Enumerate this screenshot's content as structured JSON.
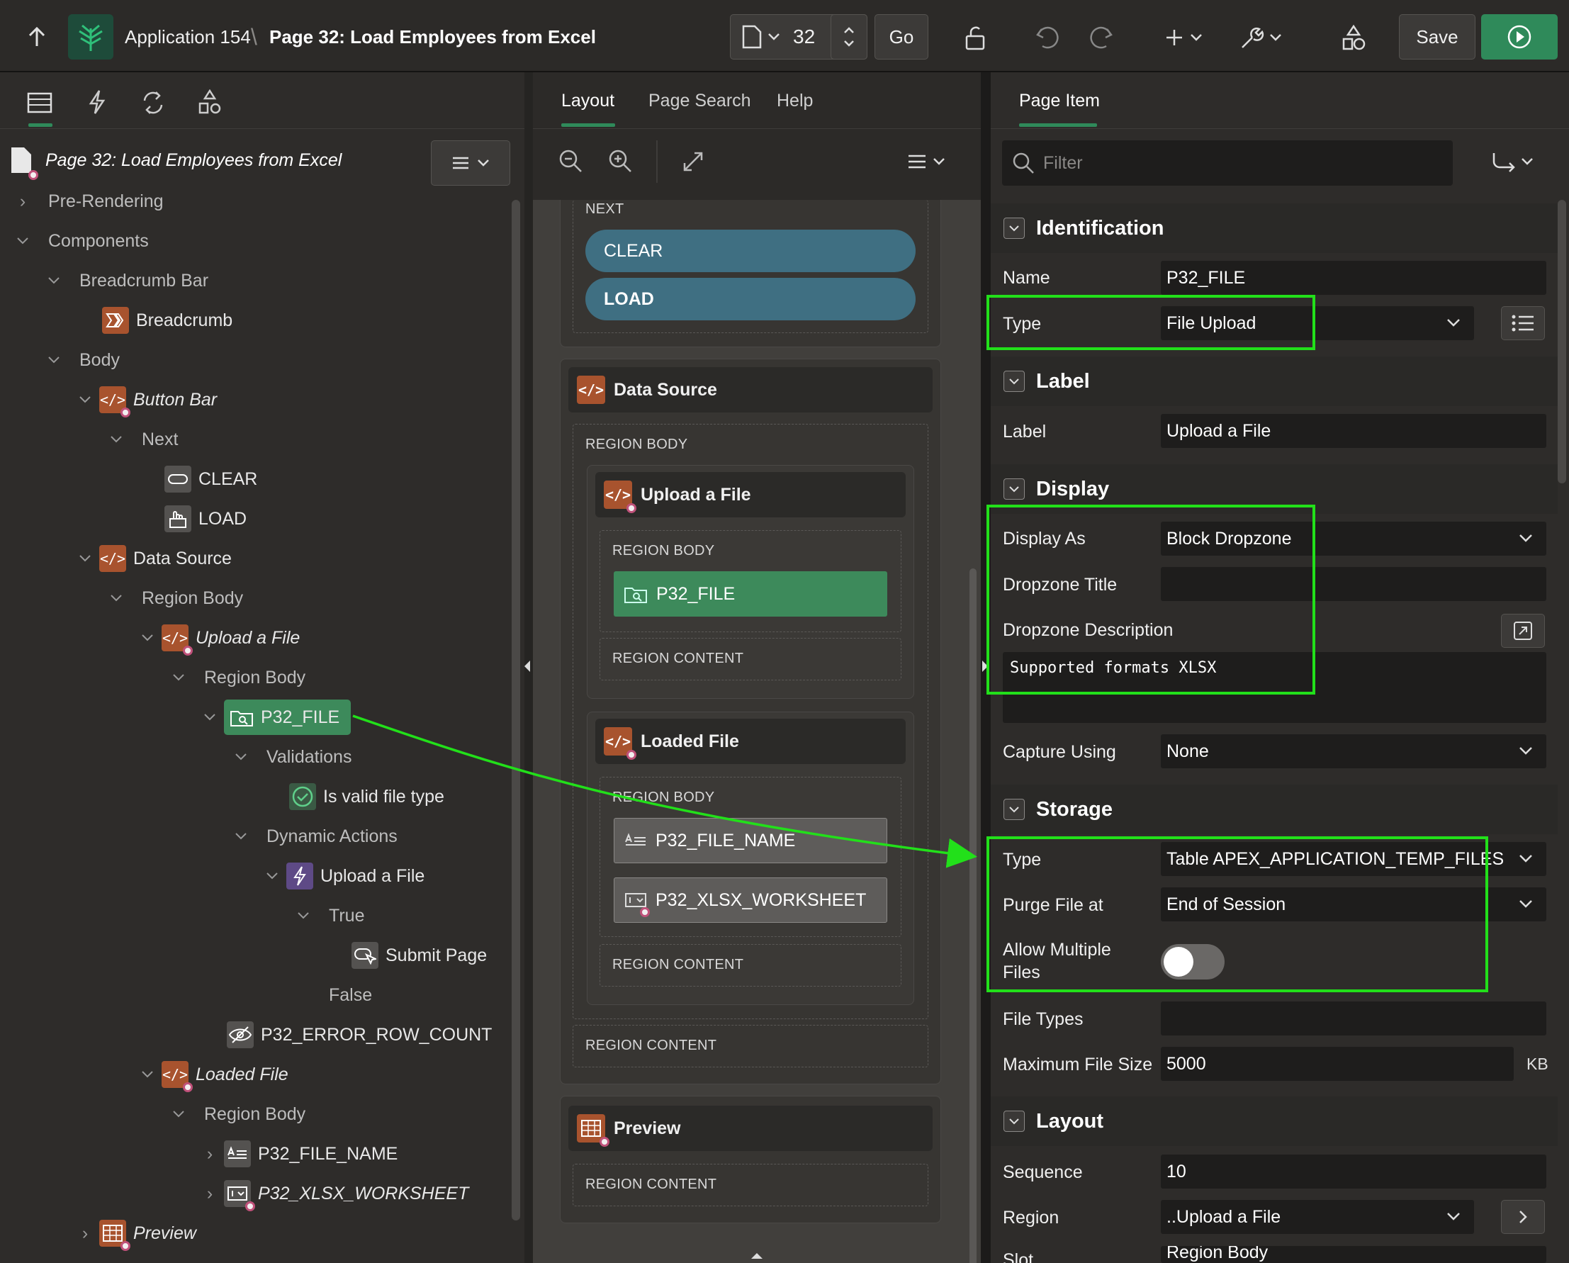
{
  "topbar": {
    "app_name": "Application 154",
    "separator": "\\",
    "page_title": "Page 32: Load Employees from Excel",
    "page_number": "32",
    "go_label": "Go",
    "save_label": "Save"
  },
  "left_panel": {
    "root_label": "Page 32: Load Employees from Excel",
    "tree": [
      {
        "label": "Pre-Rendering"
      },
      {
        "label": "Components"
      },
      {
        "label": "Breadcrumb Bar"
      },
      {
        "label": "Breadcrumb"
      },
      {
        "label": "Body"
      },
      {
        "label": "Button Bar"
      },
      {
        "label": "Next"
      },
      {
        "label": "CLEAR"
      },
      {
        "label": "LOAD"
      },
      {
        "label": "Data Source"
      },
      {
        "label": "Region Body"
      },
      {
        "label": "Upload a File"
      },
      {
        "label": "Region Body"
      },
      {
        "label": "P32_FILE"
      },
      {
        "label": "Validations"
      },
      {
        "label": "Is valid file type"
      },
      {
        "label": "Dynamic Actions"
      },
      {
        "label": "Upload a File"
      },
      {
        "label": "True"
      },
      {
        "label": "Submit Page"
      },
      {
        "label": "False"
      },
      {
        "label": "P32_ERROR_ROW_COUNT"
      },
      {
        "label": "Loaded File"
      },
      {
        "label": "Region Body"
      },
      {
        "label": "P32_FILE_NAME"
      },
      {
        "label": "P32_XLSX_WORKSHEET"
      },
      {
        "label": "Preview"
      }
    ]
  },
  "middle_panel": {
    "tabs": [
      "Layout",
      "Page Search",
      "Help"
    ],
    "next_caption": "NEXT",
    "btn_clear": "CLEAR",
    "btn_load": "LOAD",
    "data_source_title": "Data Source",
    "region_body": "REGION BODY",
    "region_content": "REGION CONTENT",
    "upload_title": "Upload a File",
    "item_file": "P32_FILE",
    "loaded_title": "Loaded File",
    "item_file_name": "P32_FILE_NAME",
    "item_worksheet": "P32_XLSX_WORKSHEET",
    "preview_title": "Preview"
  },
  "right_panel": {
    "tab": "Page Item",
    "filter_placeholder": "Filter",
    "sections": {
      "identification": "Identification",
      "label": "Label",
      "display": "Display",
      "storage": "Storage",
      "layout": "Layout"
    },
    "props": {
      "name_label": "Name",
      "name_value": "P32_FILE",
      "type_label": "Type",
      "type_value": "File Upload",
      "label_label": "Label",
      "label_value": "Upload a File",
      "display_as_label": "Display As",
      "display_as_value": "Block Dropzone",
      "dropzone_title_label": "Dropzone Title",
      "dropzone_title_value": "",
      "dropzone_desc_label": "Dropzone Description",
      "dropzone_desc_value": "Supported formats XLSX",
      "capture_label": "Capture Using",
      "capture_value": "None",
      "storage_type_label": "Type",
      "storage_type_value": "Table APEX_APPLICATION_TEMP_FILES",
      "purge_label": "Purge File at",
      "purge_value": "End of Session",
      "allow_multiple_label_1": "Allow Multiple",
      "allow_multiple_label_2": "Files",
      "allow_multiple_value": false,
      "file_types_label": "File Types",
      "file_types_value": "",
      "max_size_label": "Maximum File Size",
      "max_size_value": "5000",
      "max_size_unit": "KB",
      "sequence_label": "Sequence",
      "sequence_value": "10",
      "region_label": "Region",
      "region_value": "..Upload a File",
      "slot_label": "Slot",
      "slot_value": "Region Body"
    }
  },
  "colors": {
    "highlight_box": "#22e01a",
    "arrow": "#22e01a",
    "run_button": "#2f8a5a",
    "region_icon": "#a8532e",
    "pill_button": "#3f6f82",
    "selected_item": "#3d8a5b"
  }
}
